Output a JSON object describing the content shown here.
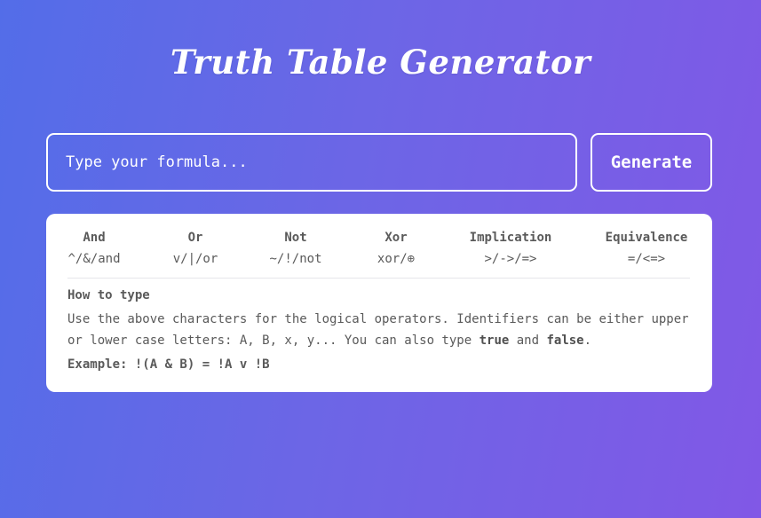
{
  "header": {
    "title": "Truth Table Generator"
  },
  "form": {
    "input_placeholder": "Type your formula...",
    "input_value": "",
    "generate_label": "Generate"
  },
  "operators": [
    {
      "name": "And",
      "syntax": "^/&/and"
    },
    {
      "name": "Or",
      "syntax": "v/|/or"
    },
    {
      "name": "Not",
      "syntax": "~/!/not"
    },
    {
      "name": "Xor",
      "syntax": "xor/⊕"
    },
    {
      "name": "Implication",
      "syntax": ">/->/=>"
    },
    {
      "name": "Equivalence",
      "syntax": "=/<=>"
    }
  ],
  "help": {
    "heading": "How to type",
    "text_part1": "Use the above characters for the logical operators. Identifiers can be either upper or lower case letters: A, B, x, y... You can also type ",
    "true_word": "true",
    "and_word": " and ",
    "false_word": "false",
    "period": ".",
    "example": "Example: !(A & B) = !A v !B"
  },
  "colors": {
    "gradient_start": "#536de8",
    "gradient_end": "#8158e6",
    "card_background": "#ffffff",
    "card_text": "#5a5a5a"
  }
}
